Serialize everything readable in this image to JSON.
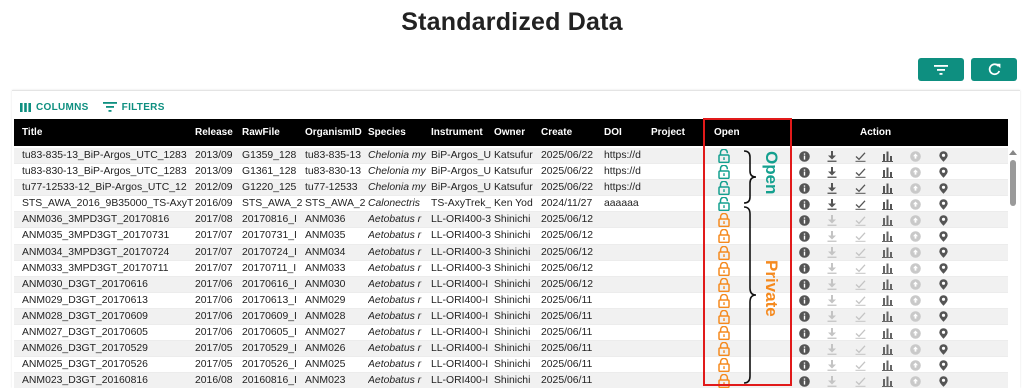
{
  "page": {
    "title": "Standardized Data"
  },
  "toolbar": {
    "columns_label": "COLUMNS",
    "filters_label": "FILTERS"
  },
  "colors": {
    "accent": "#0e8f80",
    "open_lock": "#14a08f",
    "private_lock": "#f58a1f",
    "highlight": "#e11a1a",
    "header_bg": "#000000"
  },
  "columns": [
    "Title",
    "Release",
    "RawFile",
    "OrganismID",
    "Species",
    "Instrument",
    "Owner",
    "Create",
    "DOI",
    "Project",
    "Open",
    "Action"
  ],
  "action_icons": [
    "info-icon",
    "download-icon",
    "check-icon",
    "bar-chart-icon",
    "upload-icon",
    "location-pin-icon"
  ],
  "annotations": {
    "open_label": "Open",
    "private_label": "Private"
  },
  "rows": [
    {
      "title": "tu83-835-13_BiP-Argos_UTC_1283",
      "release": "2013/09",
      "rawfile": "G1359_128",
      "organism": "tu83-835-13",
      "species": "Chelonia my",
      "instrument": "BiP-Argos_U",
      "owner": "Katsufur",
      "create": "2025/06/22",
      "doi": "https://d",
      "project": "",
      "open": "open"
    },
    {
      "title": "tu83-830-13_BiP-Argos_UTC_1283",
      "release": "2013/09",
      "rawfile": "G1361_128",
      "organism": "tu83-830-13",
      "species": "Chelonia my",
      "instrument": "BiP-Argos_U",
      "owner": "Katsufur",
      "create": "2025/06/22",
      "doi": "https://d",
      "project": "",
      "open": "open"
    },
    {
      "title": "tu77-12533-12_BiP-Argos_UTC_12",
      "release": "2012/09",
      "rawfile": "G1220_125",
      "organism": "tu77-12533",
      "species": "Chelonia my",
      "instrument": "BiP-Argos_U",
      "owner": "Katsufur",
      "create": "2025/06/22",
      "doi": "https://d",
      "project": "",
      "open": "open"
    },
    {
      "title": "STS_AWA_2016_9B35000_TS-AxyT",
      "release": "2016/09",
      "rawfile": "STS_AWA_2",
      "organism": "STS_AWA_2",
      "species": "Calonectris",
      "instrument": "TS-AxyTrek_",
      "owner": "Ken Yod",
      "create": "2024/11/27",
      "doi": "aaaaaa",
      "project": "",
      "open": "open"
    },
    {
      "title": "ANM036_3MPD3GT_20170816",
      "release": "2017/08",
      "rawfile": "20170816_I",
      "organism": "ANM036",
      "species": "Aetobatus r",
      "instrument": "LL-ORI400-3",
      "owner": "Shinichi",
      "create": "2025/06/12",
      "doi": "",
      "project": "",
      "open": "private"
    },
    {
      "title": "ANM035_3MPD3GT_20170731",
      "release": "2017/07",
      "rawfile": "20170731_I",
      "organism": "ANM035",
      "species": "Aetobatus r",
      "instrument": "LL-ORI400-3",
      "owner": "Shinichi",
      "create": "2025/06/12",
      "doi": "",
      "project": "",
      "open": "private"
    },
    {
      "title": "ANM034_3MPD3GT_20170724",
      "release": "2017/07",
      "rawfile": "20170724_I",
      "organism": "ANM034",
      "species": "Aetobatus r",
      "instrument": "LL-ORI400-3",
      "owner": "Shinichi",
      "create": "2025/06/12",
      "doi": "",
      "project": "",
      "open": "private"
    },
    {
      "title": "ANM033_3MPD3GT_20170711",
      "release": "2017/07",
      "rawfile": "20170711_I",
      "organism": "ANM033",
      "species": "Aetobatus r",
      "instrument": "LL-ORI400-3",
      "owner": "Shinichi",
      "create": "2025/06/12",
      "doi": "",
      "project": "",
      "open": "private"
    },
    {
      "title": "ANM030_D3GT_20170616",
      "release": "2017/06",
      "rawfile": "20170616_I",
      "organism": "ANM030",
      "species": "Aetobatus r",
      "instrument": "LL-ORI400-I",
      "owner": "Shinichi",
      "create": "2025/06/12",
      "doi": "",
      "project": "",
      "open": "private"
    },
    {
      "title": "ANM029_D3GT_20170613",
      "release": "2017/06",
      "rawfile": "20170613_I",
      "organism": "ANM029",
      "species": "Aetobatus r",
      "instrument": "LL-ORI400-I",
      "owner": "Shinichi",
      "create": "2025/06/11",
      "doi": "",
      "project": "",
      "open": "private"
    },
    {
      "title": "ANM028_D3GT_20170609",
      "release": "2017/06",
      "rawfile": "20170609_I",
      "organism": "ANM028",
      "species": "Aetobatus r",
      "instrument": "LL-ORI400-I",
      "owner": "Shinichi",
      "create": "2025/06/11",
      "doi": "",
      "project": "",
      "open": "private"
    },
    {
      "title": "ANM027_D3GT_20170605",
      "release": "2017/06",
      "rawfile": "20170605_I",
      "organism": "ANM027",
      "species": "Aetobatus r",
      "instrument": "LL-ORI400-I",
      "owner": "Shinichi",
      "create": "2025/06/11",
      "doi": "",
      "project": "",
      "open": "private"
    },
    {
      "title": "ANM026_D3GT_20170529",
      "release": "2017/05",
      "rawfile": "20170529_I",
      "organism": "ANM026",
      "species": "Aetobatus r",
      "instrument": "LL-ORI400-I",
      "owner": "Shinichi",
      "create": "2025/06/11",
      "doi": "",
      "project": "",
      "open": "private"
    },
    {
      "title": "ANM025_D3GT_20170526",
      "release": "2017/05",
      "rawfile": "20170526_I",
      "organism": "ANM025",
      "species": "Aetobatus r",
      "instrument": "LL-ORI400-I",
      "owner": "Shinichi",
      "create": "2025/06/11",
      "doi": "",
      "project": "",
      "open": "private"
    },
    {
      "title": "ANM023_D3GT_20160816",
      "release": "2016/08",
      "rawfile": "20160816_I",
      "organism": "ANM023",
      "species": "Aetobatus r",
      "instrument": "LL-ORI400-I",
      "owner": "Shinichi",
      "create": "2025/06/11",
      "doi": "",
      "project": "",
      "open": "private"
    }
  ]
}
